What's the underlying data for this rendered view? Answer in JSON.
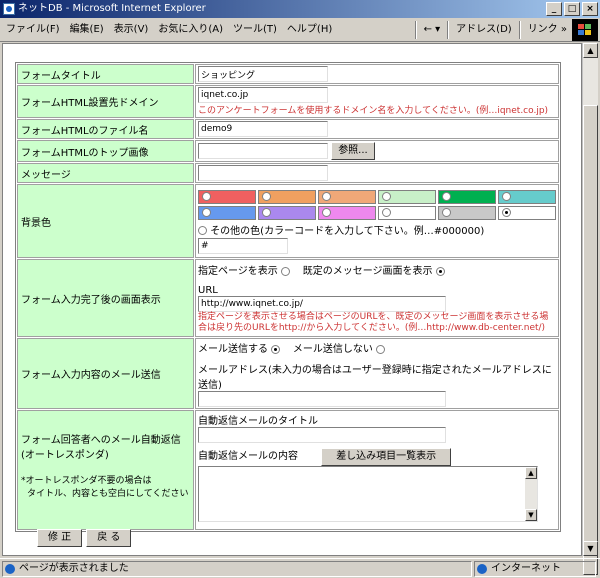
{
  "window": {
    "title": "ネットDB - Microsoft Internet Explorer",
    "buttons": [
      "_",
      "□",
      "×"
    ]
  },
  "menubar": {
    "items": [
      "ファイル(F)",
      "編集(E)",
      "表示(V)",
      "お気に入り(A)",
      "ツール(T)",
      "ヘルプ(H)"
    ],
    "back_label": "←",
    "back_dropdown": "▾",
    "address_label": "アドレス(D)",
    "links_label": "リンク",
    "more": "»"
  },
  "form": {
    "title_label": "フォームタイトル",
    "title_value": "ショッピング",
    "domain_label": "フォームHTML設置先ドメイン",
    "domain_value": "iqnet.co.jp",
    "domain_note": "このアンケートフォームを使用するドメイン名を入力してください。(例…iqnet.co.jp)",
    "filename_label": "フォームHTMLのファイル名",
    "filename_value": "demo9",
    "topimage_label": "フォームHTMLのトップ画像",
    "browse_label": "参照...",
    "message_label": "メッセージ",
    "bg_label": "背景色",
    "bg_colors": [
      "#f06060",
      "#f0a060",
      "#f0a878",
      "#c8f0c8",
      "#00b050",
      "#66cccc",
      "#6699ee",
      "#aa88ee",
      "#ee88ee",
      "#ffffff",
      "#c8c8c8",
      "#ffffff"
    ],
    "bg_selected_index": 11,
    "bg_other_label": "その他の色(カラーコードを入力して下さい。例…#000000)",
    "bg_other_value": "#",
    "complete_label": "フォーム入力完了後の画面表示",
    "complete_opt1": "指定ページを表示",
    "complete_opt2": "既定のメッセージ画面を表示",
    "url_label": "URL",
    "url_value": "http://www.iqnet.co.jp/",
    "url_note": "指定ページを表示させる場合はページのURLを、既定のメッセージ画面を表示させる場合は戻り先のURLをhttp://から入力してください。(例…http://www.db-center.net/)",
    "mail_label": "フォーム入力内容のメール送信",
    "mail_opt1": "メール送信する",
    "mail_opt2": "メール送信しない",
    "mail_addr_label": "メールアドレス(未入力の場合はユーザー登録時に指定されたメールアドレスに送信)",
    "auto_label": "フォーム回答者へのメール自動返信(オートレスポンダ)",
    "auto_note1": "*オートレスポンダ不要の場合は",
    "auto_note2": "タイトル、内容とも空白にしてください",
    "auto_title_label": "自動返信メールのタイトル",
    "auto_body_label": "自動返信メールの内容",
    "insert_button": "差し込み項目一覧表示"
  },
  "buttons": {
    "fix": "修 正",
    "back": "戻 る"
  },
  "status": {
    "text": "ページが表示されました",
    "zone": "インターネット"
  }
}
